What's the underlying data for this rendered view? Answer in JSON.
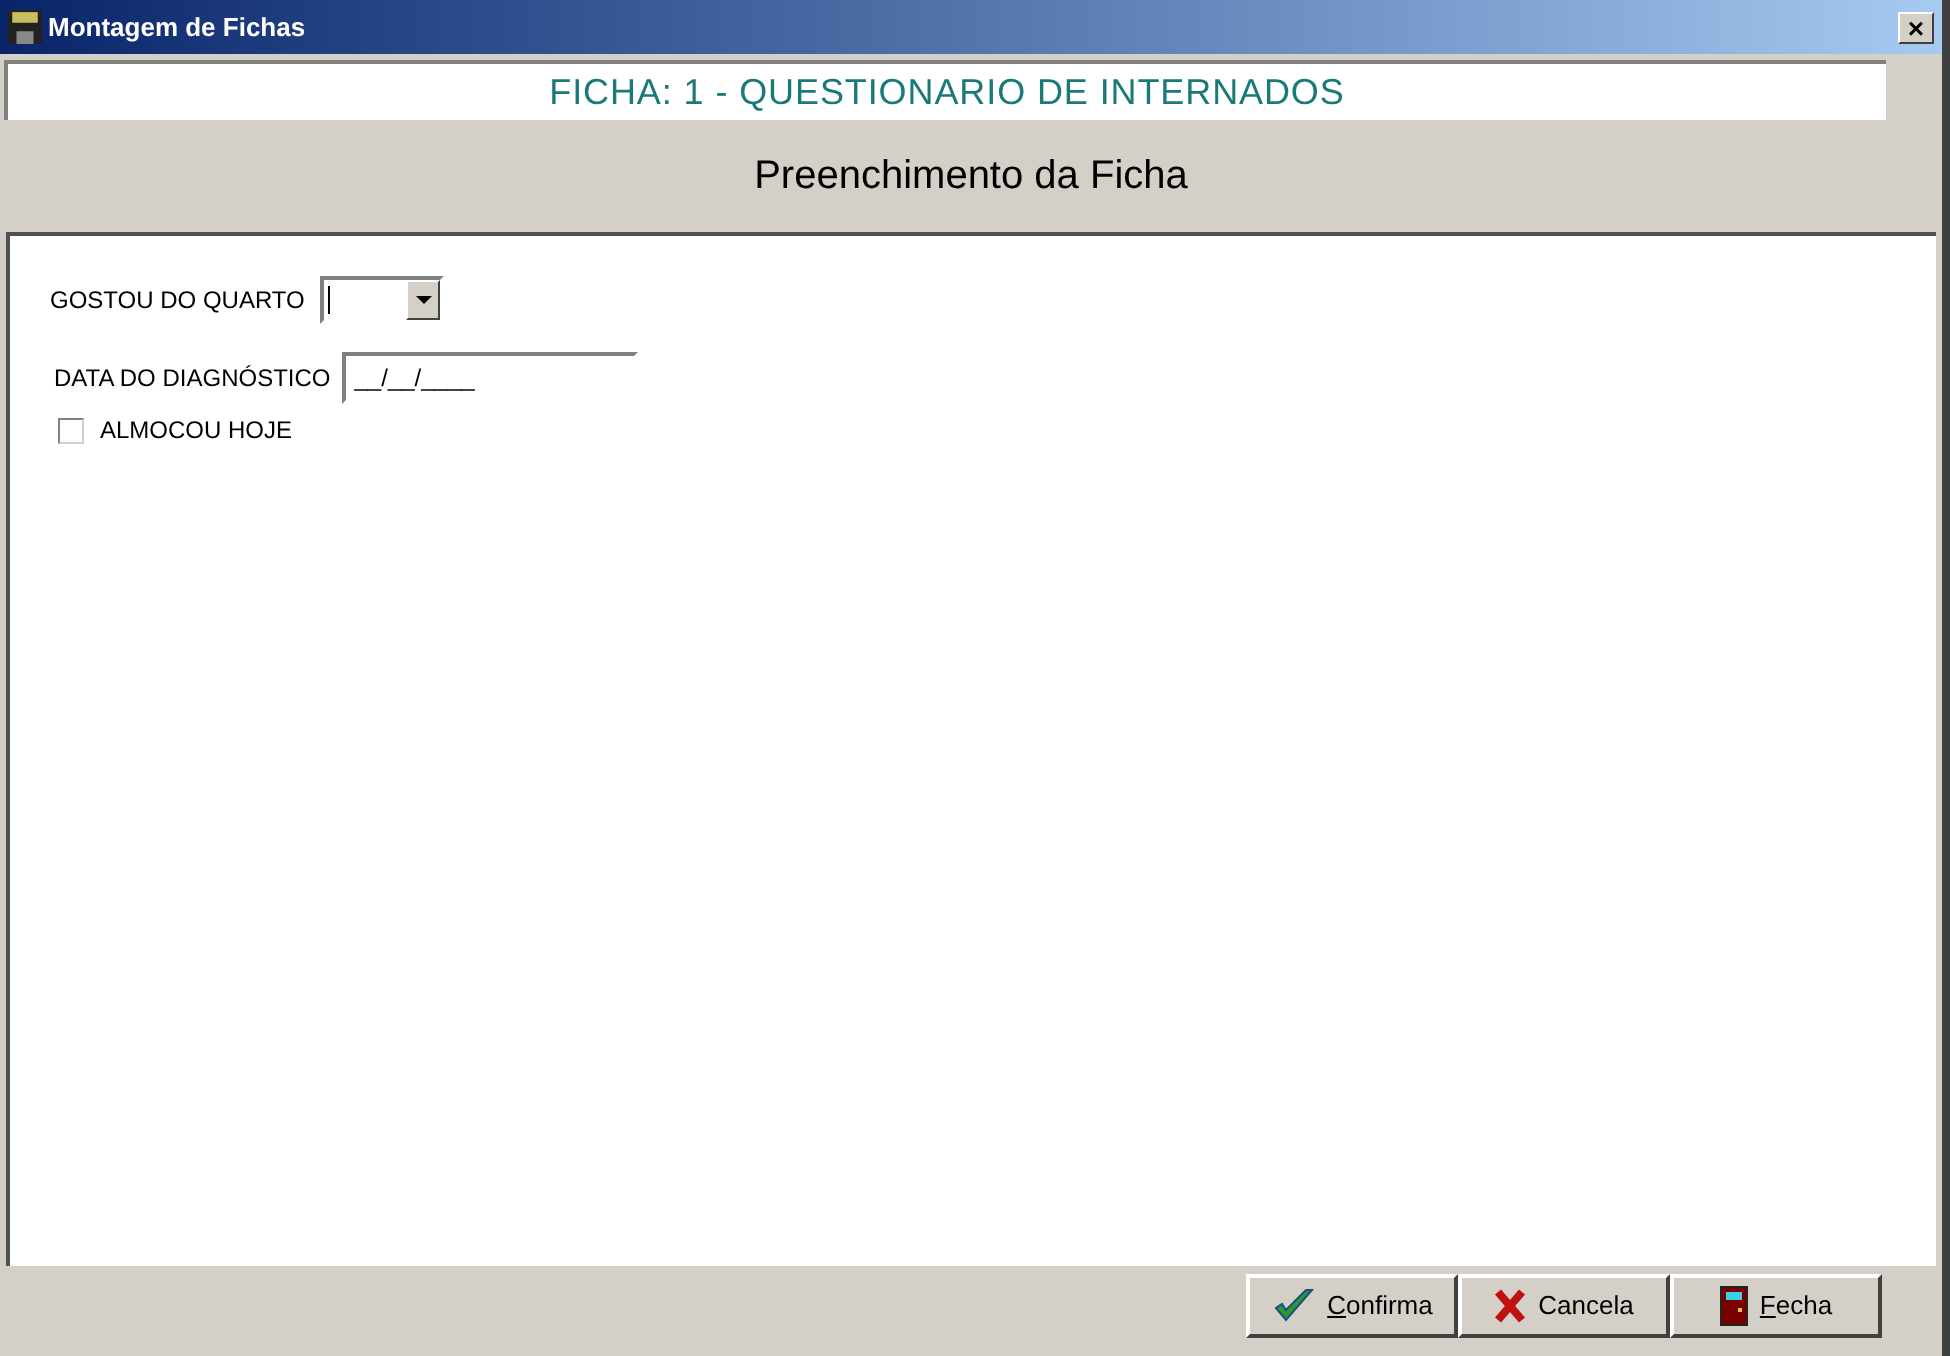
{
  "window": {
    "title": "Montagem de Fichas",
    "close": "×"
  },
  "header": "FICHA: 1 - QUESTIONARIO DE INTERNADOS",
  "subtitle": "Preenchimento da Ficha",
  "fields": [
    {
      "kind": "combo",
      "label": "GOSTOU DO QUARTO"
    },
    {
      "kind": "date",
      "label": "DATA DO DIAGNÓSTICO",
      "value": "__/__/____"
    },
    {
      "kind": "checkbox",
      "label": "ALMOCOU HOJE",
      "checked": false
    }
  ],
  "buttons": [
    {
      "kind": "check",
      "label": "Confirma",
      "underline_first": true
    },
    {
      "kind": "cross",
      "label": "Cancela",
      "underline_first": false
    },
    {
      "kind": "door",
      "label": "Fecha",
      "underline_first": true
    }
  ]
}
